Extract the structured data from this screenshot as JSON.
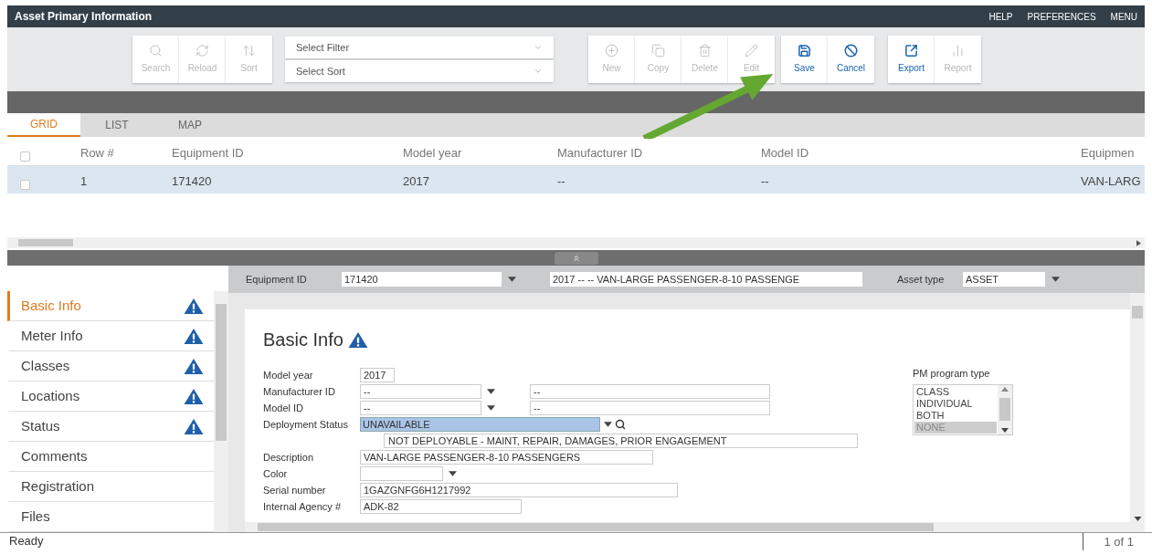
{
  "window": {
    "title": "Asset Primary Information"
  },
  "header_links": [
    "HELP",
    "PREFERENCES",
    "MENU"
  ],
  "toolbar": {
    "groups": [
      [
        {
          "label": "Search",
          "disabled": true
        },
        {
          "label": "Reload",
          "disabled": true
        },
        {
          "label": "Sort",
          "disabled": true
        }
      ],
      [
        {
          "label": "New",
          "disabled": true
        },
        {
          "label": "Copy",
          "disabled": true
        },
        {
          "label": "Delete",
          "disabled": true
        },
        {
          "label": "Edit",
          "disabled": true
        }
      ],
      [
        {
          "label": "Save",
          "disabled": false
        },
        {
          "label": "Cancel",
          "disabled": false
        }
      ],
      [
        {
          "label": "Export",
          "disabled": false
        },
        {
          "label": "Report",
          "disabled": true
        }
      ]
    ],
    "filter": {
      "placeholder": "Select Filter"
    },
    "sort": {
      "placeholder": "Select Sort"
    }
  },
  "view_tabs": [
    {
      "label": "GRID",
      "selected": true
    },
    {
      "label": "LIST",
      "selected": false
    },
    {
      "label": "MAP",
      "selected": false
    }
  ],
  "grid": {
    "header_checked": false,
    "columns": [
      "Row #",
      "Equipment ID",
      "Model year",
      "Manufacturer ID",
      "Model ID",
      "Equipmen"
    ],
    "rows": [
      {
        "checked": false,
        "selected": true,
        "cells": [
          "1",
          "171420",
          "2017",
          "--",
          "--",
          "VAN-LARG"
        ]
      }
    ]
  },
  "record_header": {
    "equipment_label": "Equipment ID",
    "equipment_value": "171420",
    "description_value": "2017 -- -- VAN-LARGE PASSENGER-8-10 PASSENGE",
    "asset_type_label": "Asset type",
    "asset_type_value": "ASSET"
  },
  "sidebar": {
    "items": [
      {
        "label": "Basic Info",
        "warning": true,
        "selected": true
      },
      {
        "label": "Meter Info",
        "warning": true,
        "selected": false
      },
      {
        "label": "Classes",
        "warning": true,
        "selected": false
      },
      {
        "label": "Locations",
        "warning": true,
        "selected": false
      },
      {
        "label": "Status",
        "warning": true,
        "selected": false
      },
      {
        "label": "Comments",
        "warning": false,
        "selected": false
      },
      {
        "label": "Registration",
        "warning": false,
        "selected": false
      },
      {
        "label": "Files",
        "warning": false,
        "selected": false
      }
    ]
  },
  "form": {
    "title": "Basic Info",
    "warning": true,
    "fields": [
      {
        "kind": "text",
        "label": "Model year",
        "value": "2017"
      },
      {
        "kind": "combo",
        "label": "Manufacturer ID",
        "value": "--",
        "second_value": "--"
      },
      {
        "kind": "combo",
        "label": "Model ID",
        "value": "--",
        "second_value": "--"
      },
      {
        "kind": "lookup",
        "label": "Deployment Status",
        "value": "UNAVAILABLE",
        "detail": "NOT DEPLOYABLE - MAINT, REPAIR, DAMAGES, PRIOR ENGAGEMENT"
      },
      {
        "kind": "text",
        "label": "Description",
        "value": "VAN-LARGE PASSENGER-8-10 PASSENGERS"
      },
      {
        "kind": "select",
        "label": "Color"
      },
      {
        "kind": "text",
        "label": "Serial number",
        "value": "1GAZGNFG6H1217992"
      },
      {
        "kind": "text",
        "label": "Internal Agency #",
        "value": "ADK-82"
      }
    ],
    "pm_program": {
      "label": "PM program type",
      "options": [
        {
          "label": "CLASS",
          "selected": false
        },
        {
          "label": "INDIVIDUAL",
          "selected": false
        },
        {
          "label": "BOTH",
          "selected": false
        },
        {
          "label": "NONE",
          "selected": true
        }
      ]
    }
  },
  "status_bar": {
    "status": "Ready",
    "page": "1 of 1"
  }
}
